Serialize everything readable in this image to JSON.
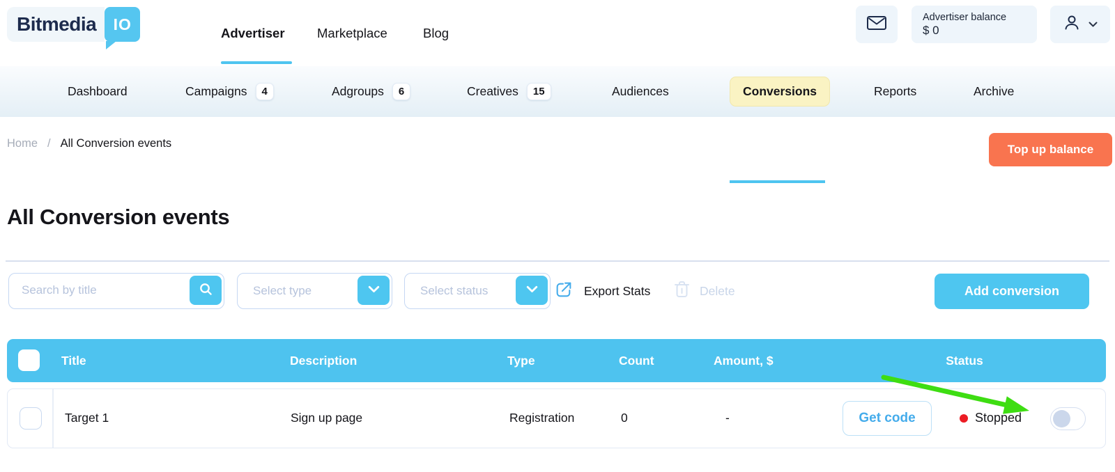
{
  "brand": {
    "name": "Bitmedia",
    "badge": "IO"
  },
  "header": {
    "nav": [
      {
        "label": "Advertiser",
        "active": true
      },
      {
        "label": "Marketplace",
        "active": false
      },
      {
        "label": "Blog",
        "active": false
      }
    ],
    "balance_label": "Advertiser balance",
    "balance_value": "$ 0"
  },
  "tabs": [
    {
      "label": "Dashboard"
    },
    {
      "label": "Campaigns",
      "badge": "4"
    },
    {
      "label": "Adgroups",
      "badge": "6"
    },
    {
      "label": "Creatives",
      "badge": "15"
    },
    {
      "label": "Audiences"
    },
    {
      "label": "Conversions",
      "active": true
    },
    {
      "label": "Reports"
    },
    {
      "label": "Archive"
    }
  ],
  "breadcrumb": {
    "home": "Home",
    "separator": "/",
    "current": "All Conversion events"
  },
  "page_title": "All Conversion events",
  "actions": {
    "top_up": "Top up balance",
    "export_stats": "Export Stats",
    "delete": "Delete",
    "add_conversion": "Add conversion",
    "get_code": "Get code"
  },
  "filters": {
    "search_placeholder": "Search by title",
    "type_placeholder": "Select type",
    "status_placeholder": "Select status"
  },
  "table": {
    "columns": {
      "title": "Title",
      "description": "Description",
      "type": "Type",
      "count": "Count",
      "amount": "Amount, $",
      "status": "Status"
    },
    "rows": [
      {
        "title": "Target 1",
        "description": "Sign up page",
        "type": "Registration",
        "count": "0",
        "amount": "-",
        "status": "Stopped",
        "toggle_state": "off"
      }
    ]
  },
  "icons": {
    "messages": "envelope-icon",
    "account": "user-icon",
    "search": "magnifier-icon",
    "dropdown": "chevron-down-icon",
    "export": "external-arrow-icon",
    "delete": "trash-icon",
    "annotation": "green-arrow"
  },
  "colors": {
    "accent_blue": "#4EC3EF",
    "orange": "#F9744F",
    "active_tab_yellow": "#FAF3C3",
    "status_red": "#EC1C24",
    "arrow_green": "#3EDD12",
    "logo_navy": "#1D2B4D"
  }
}
